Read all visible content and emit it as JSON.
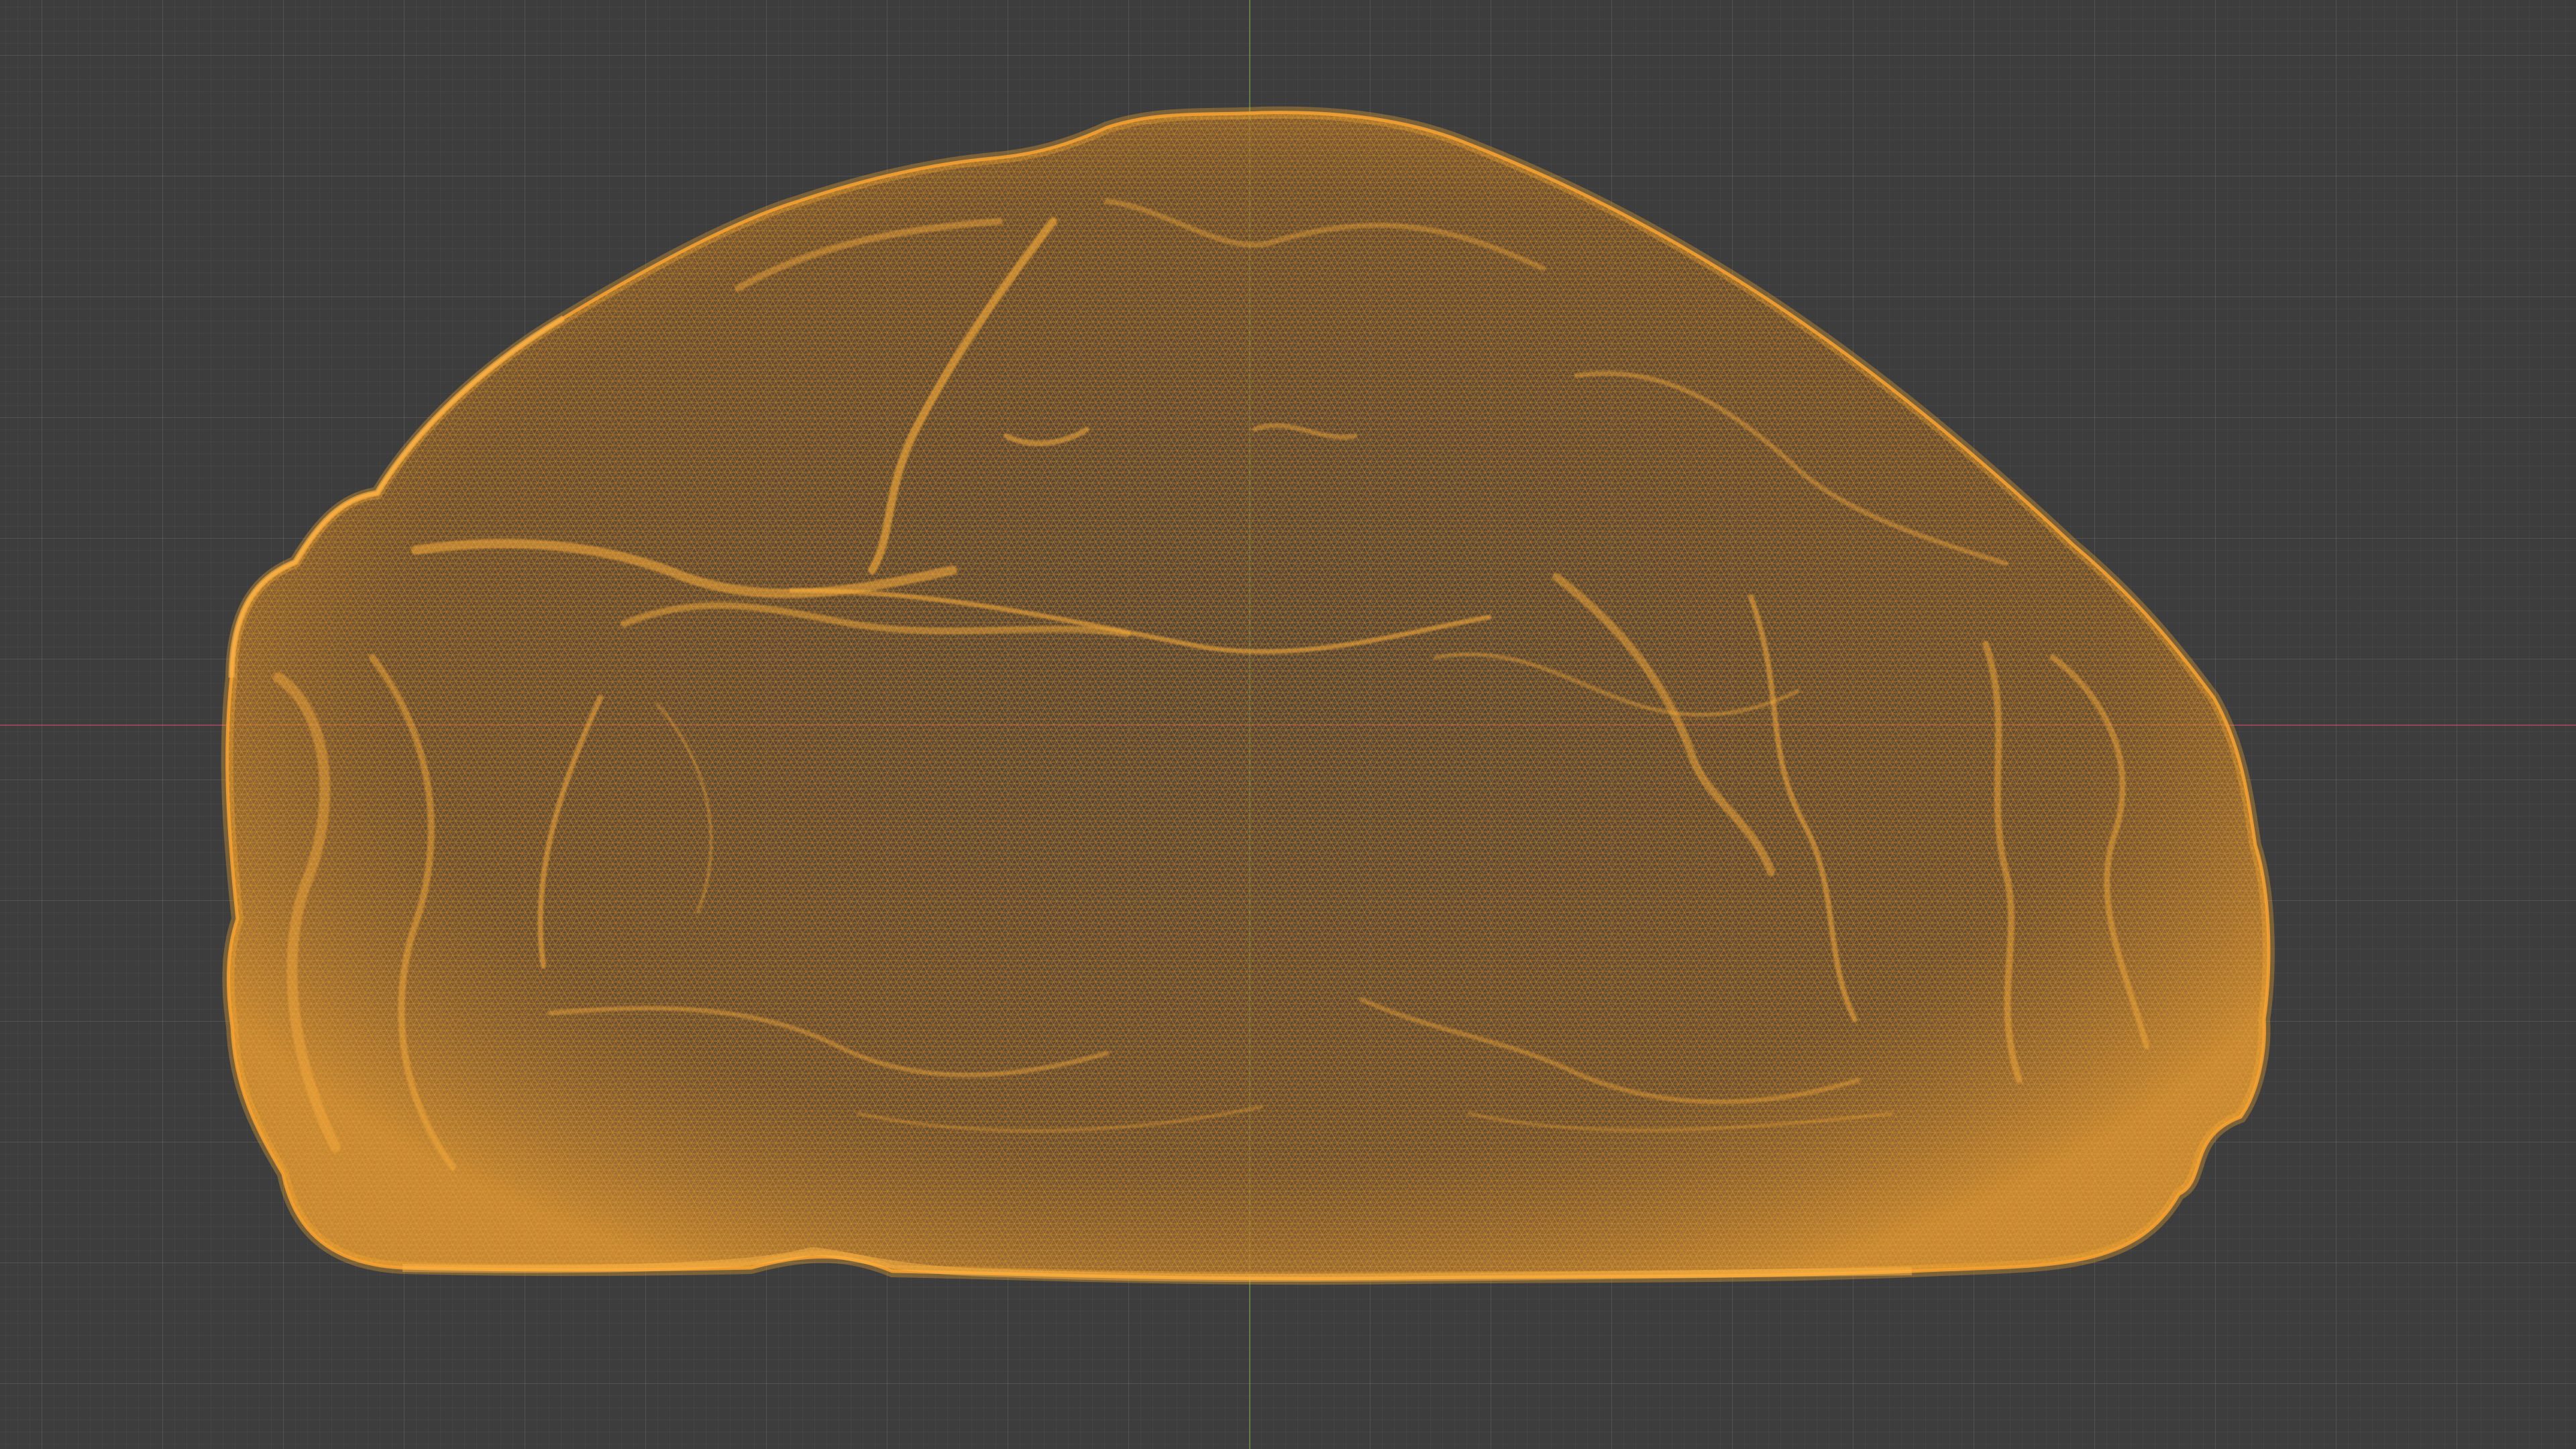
{
  "viewport": {
    "background_color": "#3d3d3d",
    "grid_visible": true,
    "x_axis_color": "#d6506e",
    "y_axis_color": "#78aa46"
  },
  "object": {
    "display": "wireframe",
    "selected": true,
    "wire_color": "#f0a030",
    "fill_color": "#7a5226"
  }
}
